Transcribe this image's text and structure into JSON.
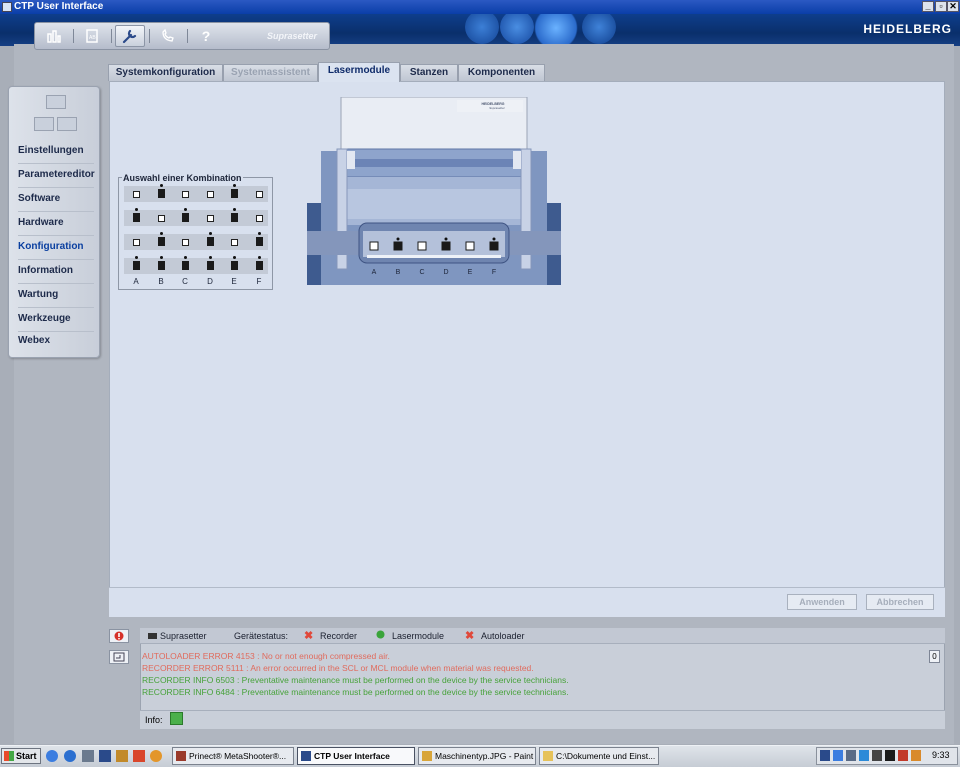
{
  "window": {
    "title": "CTP User Interface"
  },
  "header": {
    "brand": "HEIDELBERG"
  },
  "toolbar": {
    "product": "Suprasetter",
    "buttons": [
      {
        "name": "statistics-icon",
        "glyph": "▥"
      },
      {
        "name": "jobs-icon",
        "glyph": "▣"
      },
      {
        "name": "tools-icon",
        "glyph": "🔧"
      },
      {
        "name": "phone-icon",
        "glyph": "✆"
      },
      {
        "name": "help-icon",
        "glyph": "?"
      }
    ]
  },
  "sidebar": {
    "items": [
      {
        "label": "Einstellungen"
      },
      {
        "label": "Parametereditor"
      },
      {
        "label": "Software"
      },
      {
        "label": "Hardware"
      },
      {
        "label": "Konfiguration"
      },
      {
        "label": "Information"
      },
      {
        "label": "Wartung"
      },
      {
        "label": "Werkzeuge"
      },
      {
        "label": "Webex"
      }
    ],
    "selected": "Konfiguration"
  },
  "tabs": [
    {
      "label": "Systemkonfiguration",
      "state": "normal"
    },
    {
      "label": "Systemassistent",
      "state": "disabled"
    },
    {
      "label": "Lasermodule",
      "state": "active"
    },
    {
      "label": "Stanzen",
      "state": "normal"
    },
    {
      "label": "Komponenten",
      "state": "normal"
    }
  ],
  "combination": {
    "title": "Auswahl einer Kombination",
    "columns": [
      "A",
      "B",
      "C",
      "D",
      "E",
      "F"
    ],
    "rows": [
      [
        0,
        1,
        0,
        0,
        1,
        0
      ],
      [
        1,
        0,
        1,
        0,
        1,
        0
      ],
      [
        0,
        1,
        0,
        1,
        0,
        1
      ],
      [
        1,
        1,
        1,
        1,
        1,
        1
      ]
    ]
  },
  "machine": {
    "brand_plate": "HEIDELBERG",
    "model_plate": "Suprasetter",
    "modules": [
      0,
      1,
      0,
      1,
      0,
      1
    ],
    "labels": [
      "A",
      "B",
      "C",
      "D",
      "E",
      "F"
    ]
  },
  "actions": {
    "apply": "Anwenden",
    "cancel": "Abbrechen"
  },
  "status": {
    "device": "Suprasetter",
    "device_status_label": "Gerätestatus:",
    "components": [
      {
        "label": "Recorder",
        "state": "error",
        "color": "#e0483a"
      },
      {
        "label": "Lasermodule",
        "state": "ok",
        "color": "#3aa43a"
      },
      {
        "label": "Autoloader",
        "state": "error",
        "color": "#e0483a"
      }
    ],
    "scroll_count": "0",
    "messages": [
      {
        "type": "error",
        "text": "AUTOLOADER ERROR 4153 : No or not enough compressed air."
      },
      {
        "type": "error",
        "text": "RECORDER ERROR 5111 : An error occurred in the SCL or MCL module when material was requested."
      },
      {
        "type": "info",
        "text": "RECORDER INFO 6503 : Preventative maintenance must be performed on the device by the service technicians."
      },
      {
        "type": "info",
        "text": "RECORDER INFO 6484 : Preventative maintenance must be performed on the device by the service technicians."
      }
    ],
    "info_label": "Info:"
  },
  "taskbar": {
    "start": "Start",
    "tasks": [
      {
        "label": "Prinect® MetaShooter®...",
        "active": false
      },
      {
        "label": "CTP User Interface",
        "active": true
      },
      {
        "label": "Maschinentyp.JPG - Paint",
        "active": false
      },
      {
        "label": "C:\\Dokumente und Einst...",
        "active": false
      }
    ],
    "clock": "9:33"
  }
}
